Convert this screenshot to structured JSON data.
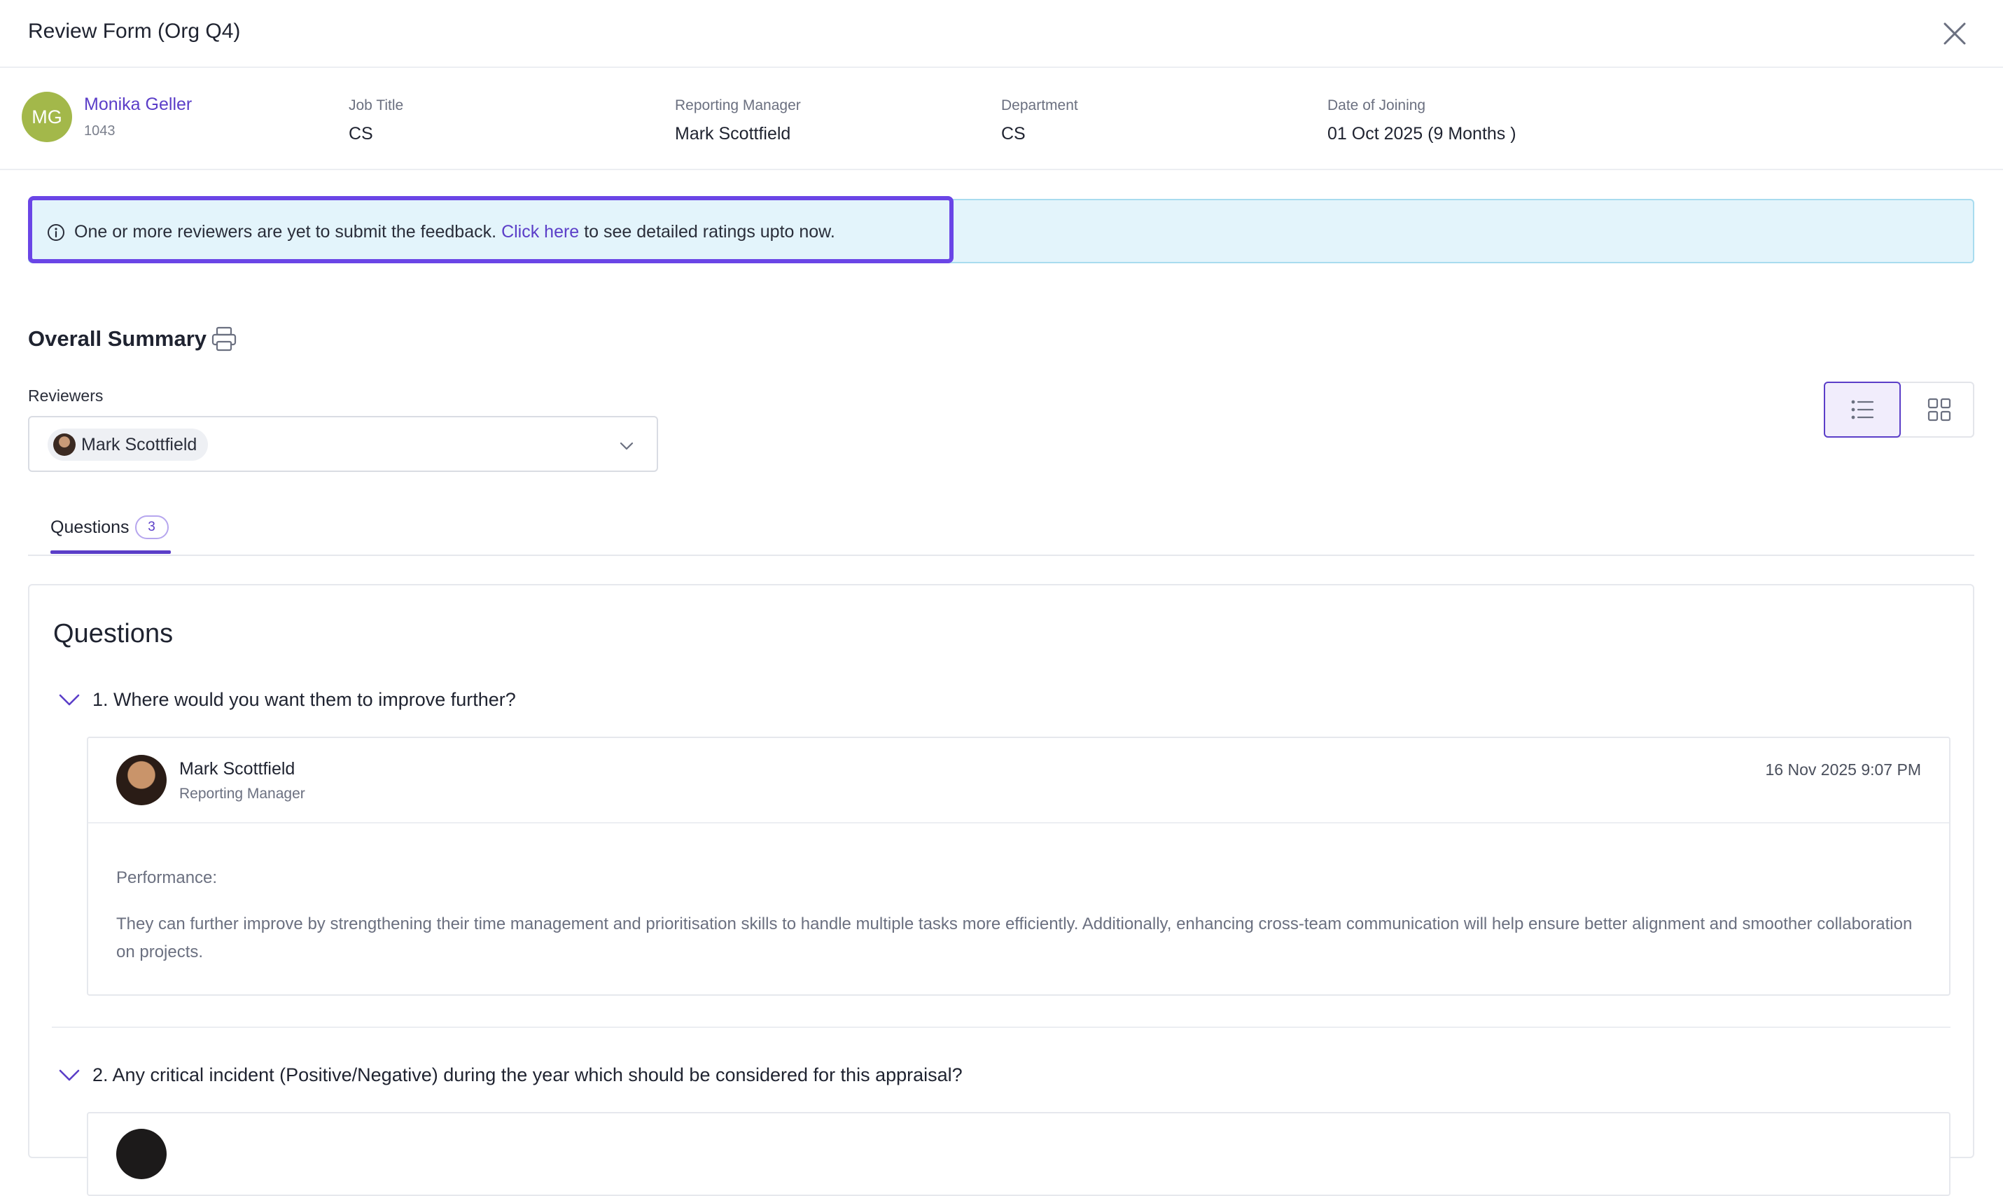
{
  "header": {
    "title": "Review Form (Org Q4)"
  },
  "employee": {
    "initials": "MG",
    "name": "Monika Geller",
    "id": "1043",
    "fields": [
      {
        "label": "Job Title",
        "value": "CS"
      },
      {
        "label": "Reporting Manager",
        "value": "Mark Scottfield"
      },
      {
        "label": "Department",
        "value": "CS"
      },
      {
        "label": "Date of Joining",
        "value": "01 Oct 2025 (9 Months )"
      }
    ]
  },
  "banner": {
    "text_before": "One or more reviewers are yet to submit the feedback.",
    "link_text": "Click here",
    "text_after": "to see detailed ratings upto now."
  },
  "summary": {
    "title": "Overall Summary",
    "reviewers_label": "Reviewers",
    "selected_reviewer": "Mark Scottfield"
  },
  "tabs": [
    {
      "label": "Questions",
      "count": "3"
    }
  ],
  "questions_panel": {
    "title": "Questions",
    "questions": [
      {
        "label": "1. Where would you want them to improve further?",
        "answer": {
          "reviewer_name": "Mark Scottfield",
          "reviewer_role": "Reporting Manager",
          "timestamp": "16 Nov 2025 9:07 PM",
          "category": "Performance:",
          "text": "They can further improve by strengthening their time management and prioritisation skills to handle multiple tasks more efficiently. Additionally, enhancing cross-team communication will help ensure better alignment and smoother collaboration on projects."
        }
      },
      {
        "label": "2. Any critical incident (Positive/Negative) during the year which should be considered for this appraisal?"
      }
    ]
  },
  "colors": {
    "accent": "#5b3ec8",
    "highlight_border": "#6a45e6",
    "banner_bg": "#e3f4fb",
    "avatar_bg": "#a3b84a"
  },
  "icons": {
    "close": "close-icon",
    "info": "info-icon",
    "print": "printer-icon",
    "chevron": "chevron-down-icon",
    "list_view": "list-view-icon",
    "grid_view": "grid-view-icon"
  }
}
